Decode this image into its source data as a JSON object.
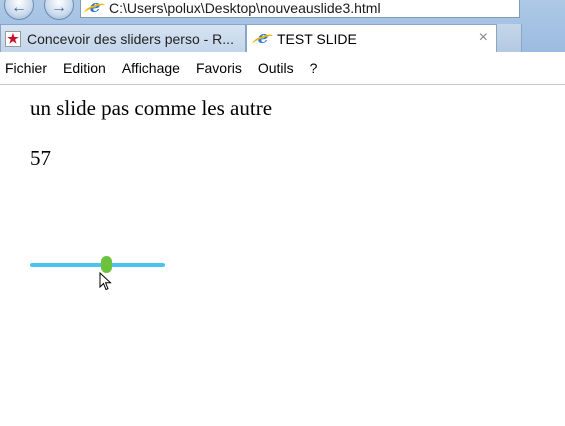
{
  "window": {
    "address": "C:\\Users\\polux\\Desktop\\nouveauslide3.html"
  },
  "tabs": [
    {
      "label": "Concevoir des sliders perso - R...",
      "icon": "pdf-icon",
      "active": false
    },
    {
      "label": "TEST SLIDE",
      "icon": "ie-icon",
      "active": true,
      "close": "×"
    }
  ],
  "menu": [
    "Fichier",
    "Edition",
    "Affichage",
    "Favoris",
    "Outils",
    "?"
  ],
  "page": {
    "heading": "un slide pas comme les autre",
    "value": "57"
  },
  "slider": {
    "value": 57,
    "track_color": "#4cc3ef",
    "thumb_color": "#6cc23a"
  }
}
